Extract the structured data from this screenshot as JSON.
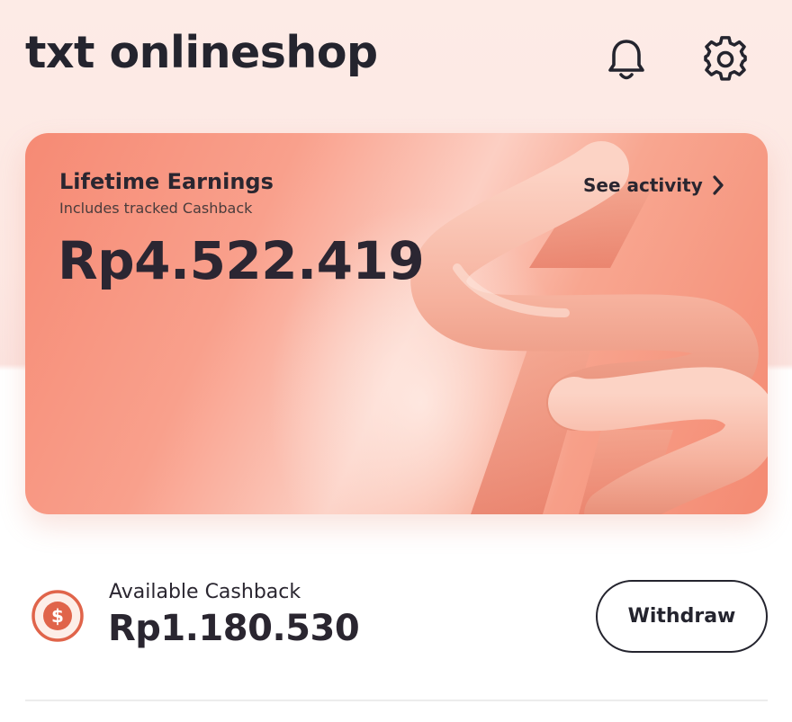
{
  "header": {
    "title": "txt onlineshop",
    "notification_icon": "bell-icon",
    "settings_icon": "gear-icon"
  },
  "earnings_card": {
    "title": "Lifetime Earnings",
    "subtitle": "Includes tracked Cashback",
    "amount": "Rp4.522.419",
    "see_activity_label": "See activity",
    "see_activity_icon": "chevron-right-icon",
    "accent_color": "#f68a74",
    "art_icon": "lightning-bolt-3d-art"
  },
  "cashback": {
    "icon": "dollar-coin-icon",
    "label": "Available Cashback",
    "amount": "Rp1.180.530",
    "withdraw_label": "Withdraw",
    "accent_color": "#e0644a"
  }
}
